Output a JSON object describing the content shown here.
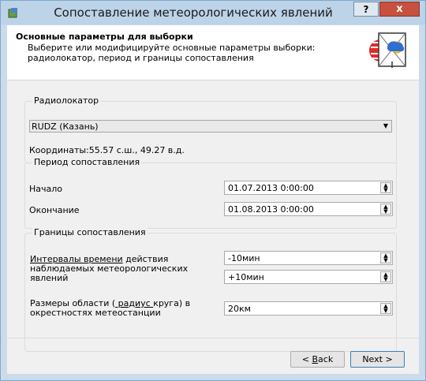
{
  "window": {
    "title": "Сопоставление метеорологических явлений",
    "help_label": "?",
    "close_label": "x"
  },
  "header": {
    "title": "Основные параметры для выборки",
    "description_line1": "Выберите или модифицируйте основные параметры выборки:",
    "description_line2": "радиолокатор, период и границы сопоставления"
  },
  "radar": {
    "group_label": "Радиолокатор",
    "selected": "RUDZ (Казань)",
    "coordinates": "Координаты:55.57 с.ш., 49.27 в.д."
  },
  "period": {
    "group_label": "Период сопоставления",
    "start_label": "Начало",
    "start_value": "01.07.2013 0:00:00",
    "end_label": "Окончание",
    "end_value": "01.08.2013 0:00:00"
  },
  "bounds": {
    "group_label": "Границы сопоставления",
    "interval_label_u": "Интервалы времени",
    "interval_label_rest1": " действия",
    "interval_label_line2": "наблюдаемых метеорологических",
    "interval_label_line3": "явлений",
    "interval_from": "-10мин",
    "interval_to": "+10мин",
    "area_label_pre": "Размеры области (",
    "area_label_u": " радиус ",
    "area_label_post": "круга) в",
    "area_label_line2": "окрестностях метеостанции",
    "area_value": "20км"
  },
  "buttons": {
    "back_u": "B",
    "back_rest": "ack",
    "back_prefix": "< ",
    "next_label": "Next >"
  }
}
